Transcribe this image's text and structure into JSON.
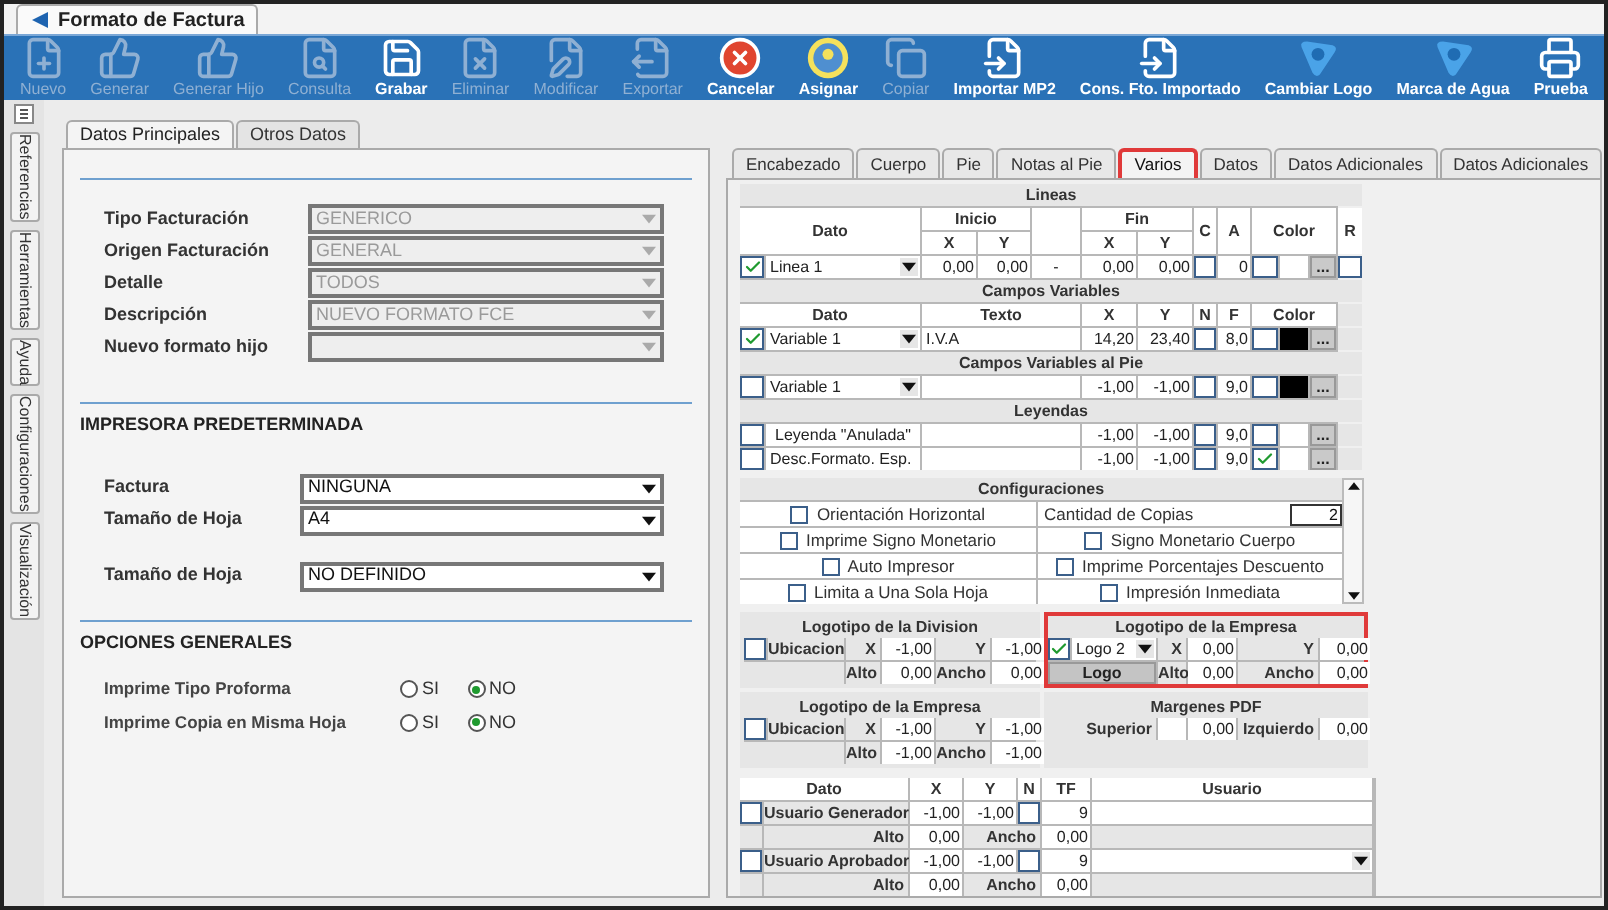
{
  "window": {
    "title": "Formato de Factura"
  },
  "toolbar": [
    {
      "label": "Nuevo",
      "disabled": true
    },
    {
      "label": "Generar",
      "disabled": true
    },
    {
      "label": "Generar Hijo",
      "disabled": true
    },
    {
      "label": "Consulta",
      "disabled": true
    },
    {
      "label": "Grabar",
      "disabled": false
    },
    {
      "label": "Eliminar",
      "disabled": true
    },
    {
      "label": "Modificar",
      "disabled": true
    },
    {
      "label": "Exportar",
      "disabled": true
    },
    {
      "label": "Cancelar",
      "disabled": false
    },
    {
      "label": "Asignar",
      "disabled": false
    },
    {
      "label": "Copiar",
      "disabled": true
    },
    {
      "label": "Importar MP2",
      "disabled": false
    },
    {
      "label": "Cons. Fto. Importado",
      "disabled": false
    },
    {
      "label": "Cambiar Logo",
      "disabled": false
    },
    {
      "label": "Marca de Agua",
      "disabled": false
    },
    {
      "label": "Prueba",
      "disabled": false
    }
  ],
  "side_tabs": [
    "Referencias",
    "Herramientas",
    "Ayuda",
    "Configuraciones",
    "Visualización"
  ],
  "left_tabs": [
    {
      "label": "Datos Principales",
      "selected": true
    },
    {
      "label": "Otros Datos",
      "selected": false
    }
  ],
  "main_fields": [
    {
      "label": "Tipo Facturación",
      "value": "GENERICO",
      "disabled": true
    },
    {
      "label": "Origen Facturación",
      "value": "GENERAL",
      "disabled": true
    },
    {
      "label": "Detalle",
      "value": "TODOS",
      "disabled": true
    },
    {
      "label": "Descripción",
      "value": "NUEVO FORMATO FCE",
      "disabled": true
    },
    {
      "label": "Nuevo formato hijo",
      "disabled": true
    }
  ],
  "printer": {
    "heading": "IMPRESORA PREDETERMINADA",
    "fields": [
      {
        "label": "Factura",
        "value": "NINGUNA",
        "disabled": false
      },
      {
        "label": "Tamaño de Hoja",
        "value": "A4",
        "disabled": false
      },
      {
        "label": "Tamaño de Hoja",
        "value": "NO DEFINIDO",
        "disabled": false
      }
    ]
  },
  "general": {
    "heading": "OPCIONES GENERALES",
    "options": [
      {
        "label": "Imprime Tipo Proforma",
        "choices": [
          {
            "label": "SI",
            "selected": false
          },
          {
            "label": "NO",
            "selected": true
          }
        ]
      },
      {
        "label": "Imprime Copia en Misma Hoja",
        "choices": [
          {
            "label": "SI",
            "selected": false
          },
          {
            "label": "NO",
            "selected": true
          }
        ]
      }
    ]
  },
  "right_tabs": [
    {
      "label": "Encabezado",
      "selected": false,
      "highlighted": false
    },
    {
      "label": "Cuerpo",
      "selected": false,
      "highlighted": false
    },
    {
      "label": "Pie",
      "selected": false,
      "highlighted": false
    },
    {
      "label": "Notas al Pie",
      "selected": false,
      "highlighted": false
    },
    {
      "label": "Varios",
      "selected": true,
      "highlighted": true
    },
    {
      "label": "Datos",
      "selected": false,
      "highlighted": false
    },
    {
      "label": "Datos Adicionales",
      "selected": false,
      "highlighted": false
    },
    {
      "label": "Datos Adicionales",
      "selected": false,
      "highlighted": false
    }
  ],
  "main_grid": [
    {
      "kind": "title",
      "text": "Lineas"
    },
    {
      "kind": "head",
      "text": "Dato"
    },
    {
      "kind": "head",
      "text": "Inicio"
    },
    {
      "kind": "blank"
    },
    {
      "kind": "head",
      "text": "Fin"
    },
    {
      "kind": "head",
      "text": "C"
    },
    {
      "kind": "head",
      "text": "A"
    },
    {
      "kind": "head",
      "text": "Color"
    },
    {
      "kind": "head",
      "text": "R"
    },
    {
      "kind": "head",
      "text": "X"
    },
    {
      "kind": "head",
      "text": "Y"
    },
    {
      "kind": "head",
      "text": "X"
    },
    {
      "kind": "head",
      "text": "Y"
    },
    {
      "kind": "check",
      "checked": true
    },
    {
      "kind": "select",
      "value": "Linea 1"
    },
    {
      "kind": "num",
      "text": "0,00"
    },
    {
      "kind": "num",
      "text": "0,00"
    },
    {
      "kind": "center",
      "text": "-"
    },
    {
      "kind": "num",
      "text": "0,00"
    },
    {
      "kind": "num",
      "text": "0,00"
    },
    {
      "kind": "check",
      "checked": false
    },
    {
      "kind": "num",
      "text": "0"
    },
    {
      "kind": "check",
      "checked": false
    },
    {
      "kind": "blank"
    },
    {
      "kind": "dots",
      "text": "..."
    },
    {
      "kind": "check",
      "checked": false
    },
    {
      "kind": "title",
      "text": "Campos Variables"
    },
    {
      "kind": "head",
      "text": "Dato"
    },
    {
      "kind": "head",
      "text": "Texto"
    },
    {
      "kind": "head",
      "text": "X"
    },
    {
      "kind": "head",
      "text": "Y"
    },
    {
      "kind": "head",
      "text": "N"
    },
    {
      "kind": "head",
      "text": "F"
    },
    {
      "kind": "head",
      "text": "Color"
    },
    {
      "kind": "gap"
    },
    {
      "kind": "check",
      "checked": true
    },
    {
      "kind": "select",
      "value": "Variable 1"
    },
    {
      "kind": "text",
      "text": "I.V.A"
    },
    {
      "kind": "num",
      "text": "14,20"
    },
    {
      "kind": "num",
      "text": "23,40"
    },
    {
      "kind": "check",
      "checked": false
    },
    {
      "kind": "num",
      "text": "8,0"
    },
    {
      "kind": "check",
      "checked": false
    },
    {
      "kind": "swatch",
      "color": "#000000"
    },
    {
      "kind": "dots",
      "text": "..."
    },
    {
      "kind": "gap"
    },
    {
      "kind": "title",
      "text": "Campos Variables al Pie"
    },
    {
      "kind": "check",
      "checked": false
    },
    {
      "kind": "select",
      "value": "Variable 1"
    },
    {
      "kind": "blank"
    },
    {
      "kind": "num",
      "text": "-1,00"
    },
    {
      "kind": "num",
      "text": "-1,00"
    },
    {
      "kind": "check",
      "checked": false
    },
    {
      "kind": "num",
      "text": "9,0"
    },
    {
      "kind": "check",
      "checked": false
    },
    {
      "kind": "swatch",
      "color": "#000000"
    },
    {
      "kind": "dots",
      "text": "..."
    },
    {
      "kind": "gap"
    },
    {
      "kind": "title",
      "text": "Leyendas"
    },
    {
      "kind": "check",
      "checked": false
    },
    {
      "kind": "center",
      "text": "Leyenda \"Anulada\""
    },
    {
      "kind": "blank"
    },
    {
      "kind": "num",
      "text": "-1,00"
    },
    {
      "kind": "num",
      "text": "-1,00"
    },
    {
      "kind": "check",
      "checked": false
    },
    {
      "kind": "num",
      "text": "9,0"
    },
    {
      "kind": "check",
      "checked": false
    },
    {
      "kind": "blank"
    },
    {
      "kind": "dots",
      "text": "..."
    },
    {
      "kind": "gap"
    },
    {
      "kind": "check",
      "checked": false
    },
    {
      "kind": "text",
      "text": "Desc.Formato. Esp."
    },
    {
      "kind": "blank"
    },
    {
      "kind": "num",
      "text": "-1,00"
    },
    {
      "kind": "num",
      "text": "-1,00"
    },
    {
      "kind": "check",
      "checked": false
    },
    {
      "kind": "num",
      "text": "9,0"
    },
    {
      "kind": "check",
      "checked": true
    },
    {
      "kind": "blank"
    },
    {
      "kind": "dots",
      "text": "..."
    },
    {
      "kind": "gap"
    }
  ],
  "configuraciones": {
    "title": "Configuraciones",
    "rows": [
      [
        {
          "kind": "check",
          "label": "Orientación Horizontal",
          "checked": false
        },
        {
          "kind": "number",
          "label": "Cantidad de Copias",
          "value": "2"
        }
      ],
      [
        {
          "kind": "check",
          "label": "Imprime Signo Monetario",
          "checked": false
        },
        {
          "kind": "check",
          "label": "Signo Monetario Cuerpo",
          "checked": false
        }
      ],
      [
        {
          "kind": "check",
          "label": "Auto Impresor",
          "checked": false
        },
        {
          "kind": "check",
          "label": "Imprime Porcentajes Descuento",
          "checked": false
        }
      ],
      [
        {
          "kind": "check",
          "label": "Limita a Una Sola Hoja",
          "checked": false
        },
        {
          "kind": "check",
          "label": "Impresión Inmediata",
          "checked": false
        }
      ]
    ]
  },
  "logo_blocks": [
    {
      "title": "Logotipo de la Division",
      "highlighted": false,
      "cells": [
        {
          "kind": "check",
          "checked": false
        },
        {
          "kind": "label",
          "text": "Ubicacion"
        },
        {
          "kind": "label",
          "text": "X"
        },
        {
          "kind": "num",
          "text": "-1,00"
        },
        {
          "kind": "label",
          "text": "Y"
        },
        {
          "kind": "num",
          "text": "-1,00"
        },
        {
          "kind": "gap"
        },
        {
          "kind": "label",
          "text": "Alto"
        },
        {
          "kind": "num",
          "text": "0,00"
        },
        {
          "kind": "label",
          "text": "Ancho"
        },
        {
          "kind": "num",
          "text": "0,00"
        }
      ]
    },
    {
      "title": "Logotipo de la Empresa",
      "highlighted": true,
      "cells": [
        {
          "kind": "check",
          "checked": true
        },
        {
          "kind": "select",
          "value": "Logo 2"
        },
        {
          "kind": "label",
          "text": "X"
        },
        {
          "kind": "num",
          "text": "0,00"
        },
        {
          "kind": "label",
          "text": "Y"
        },
        {
          "kind": "num",
          "text": "0,00"
        },
        {
          "kind": "button",
          "text": "Logo"
        },
        {
          "kind": "label",
          "text": "Alto"
        },
        {
          "kind": "num",
          "text": "0,00"
        },
        {
          "kind": "label",
          "text": "Ancho"
        },
        {
          "kind": "num",
          "text": "0,00"
        }
      ]
    },
    {
      "title": "Logotipo de la Empresa",
      "highlighted": false,
      "cells": [
        {
          "kind": "check",
          "checked": false
        },
        {
          "kind": "label",
          "text": "Ubicacion"
        },
        {
          "kind": "label",
          "text": "X"
        },
        {
          "kind": "num",
          "text": "-1,00"
        },
        {
          "kind": "label",
          "text": "Y"
        },
        {
          "kind": "num",
          "text": "-1,00"
        },
        {
          "kind": "gap"
        },
        {
          "kind": "label",
          "text": "Alto"
        },
        {
          "kind": "num",
          "text": "-1,00"
        },
        {
          "kind": "label",
          "text": "Ancho"
        },
        {
          "kind": "num",
          "text": "-1,00"
        }
      ]
    },
    {
      "title": "Margenes PDF",
      "highlighted": false,
      "cells": [
        {
          "kind": "label",
          "text": "Superior"
        },
        {
          "kind": "blank"
        },
        {
          "kind": "num",
          "text": "0,00"
        },
        {
          "kind": "label",
          "text": "Izquierdo"
        },
        {
          "kind": "num",
          "text": "0,00"
        }
      ]
    }
  ],
  "user_grid": [
    {
      "kind": "head",
      "text": "Dato"
    },
    {
      "kind": "head",
      "text": "X"
    },
    {
      "kind": "head",
      "text": "Y"
    },
    {
      "kind": "head",
      "text": "N"
    },
    {
      "kind": "head",
      "text": "TF"
    },
    {
      "kind": "head",
      "text": "Usuario"
    },
    {
      "kind": "check",
      "checked": false
    },
    {
      "kind": "label",
      "text": "Usuario Generador"
    },
    {
      "kind": "num",
      "text": "-1,00"
    },
    {
      "kind": "num",
      "text": "-1,00"
    },
    {
      "kind": "check",
      "checked": false
    },
    {
      "kind": "num",
      "text": "9"
    },
    {
      "kind": "blank"
    },
    {
      "kind": "gap"
    },
    {
      "kind": "label",
      "text": "Alto"
    },
    {
      "kind": "num",
      "text": "0,00"
    },
    {
      "kind": "label",
      "text": "Ancho"
    },
    {
      "kind": "num",
      "text": "0,00"
    },
    {
      "kind": "gap"
    },
    {
      "kind": "check",
      "checked": false
    },
    {
      "kind": "label",
      "text": "Usuario Aprobador"
    },
    {
      "kind": "num",
      "text": "-1,00"
    },
    {
      "kind": "num",
      "text": "-1,00"
    },
    {
      "kind": "check",
      "checked": false
    },
    {
      "kind": "num",
      "text": "9"
    },
    {
      "kind": "select"
    },
    {
      "kind": "gap"
    },
    {
      "kind": "label",
      "text": "Alto"
    },
    {
      "kind": "num",
      "text": "0,00"
    },
    {
      "kind": "label",
      "text": "Ancho"
    },
    {
      "kind": "num",
      "text": "0,00"
    },
    {
      "kind": "gap"
    }
  ]
}
